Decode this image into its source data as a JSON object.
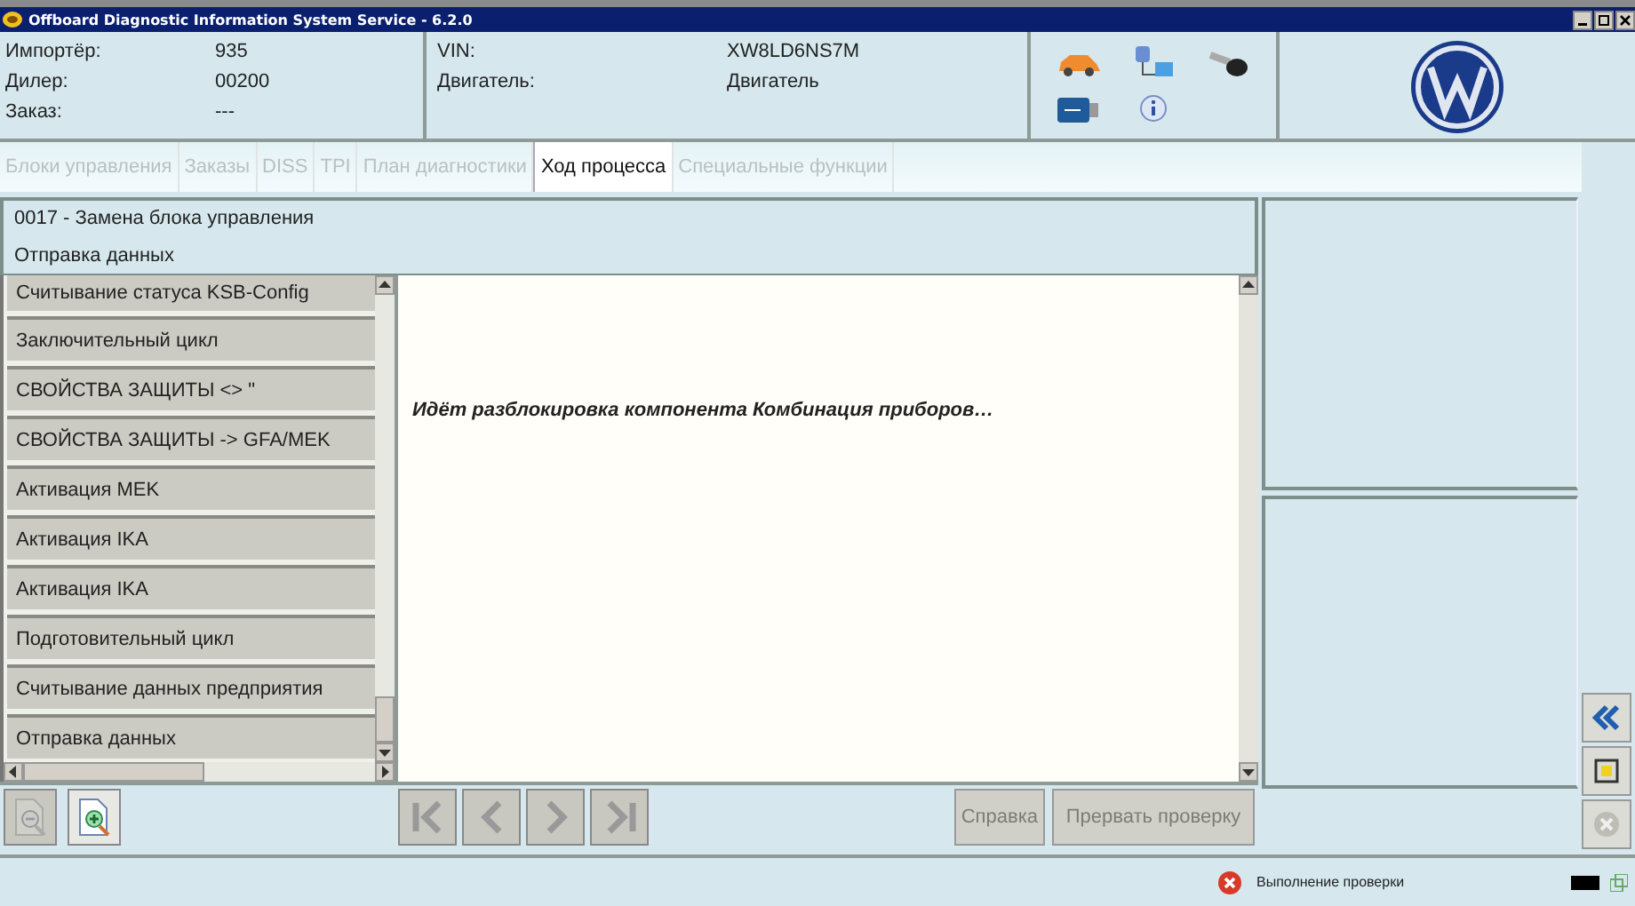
{
  "window": {
    "title": "Offboard Diagnostic Information System Service - 6.2.0"
  },
  "info": [
    {
      "label": "Импортёр:",
      "value": "935"
    },
    {
      "label": "Дилер:",
      "value": "00200"
    },
    {
      "label": "Заказ:",
      "value": "---"
    }
  ],
  "vehicle": [
    {
      "label": "VIN:",
      "value": "XW8LD6NS7M"
    },
    {
      "label": "Двигатель:",
      "value": "Двигатель"
    }
  ],
  "tabs": [
    {
      "label": "Блоки управления",
      "selected": false,
      "disabled": true
    },
    {
      "label": "Заказы",
      "selected": false,
      "disabled": true
    },
    {
      "label": "DISS",
      "selected": false,
      "disabled": true
    },
    {
      "label": "TPI",
      "selected": false,
      "disabled": true
    },
    {
      "label": "План диагностики",
      "selected": false,
      "disabled": true
    },
    {
      "label": "Ход процесса",
      "selected": true,
      "disabled": false
    },
    {
      "label": "Специальные функции",
      "selected": false,
      "disabled": true
    }
  ],
  "procedure": {
    "title": "0017 - Замена блока управления",
    "step": "Отправка данных"
  },
  "steps": [
    {
      "label": "Считывание статуса KSB-Config"
    },
    {
      "label": "Заключительный цикл"
    },
    {
      "label": "СВОЙСТВА ЗАЩИТЫ <> \""
    },
    {
      "label": "СВОЙСТВА ЗАЩИТЫ -> GFA/MEK"
    },
    {
      "label": "Активация MEK"
    },
    {
      "label": "Активация IKA"
    },
    {
      "label": "Активация IKA"
    },
    {
      "label": "Подготовительный цикл"
    },
    {
      "label": "Считывание данных предприятия"
    },
    {
      "label": "Отправка данных"
    }
  ],
  "message": "Идёт разблокировка компонента Комбинация приборов…",
  "zoom_buttons": [
    {
      "disabled": true
    },
    {
      "disabled": false
    }
  ],
  "nav_buttons": [
    {
      "disabled": true
    },
    {
      "disabled": true
    },
    {
      "disabled": true
    },
    {
      "disabled": true
    }
  ],
  "buttons": [
    {
      "label": "Справка",
      "disabled": true
    },
    {
      "label": "Прервать проверку",
      "disabled": true
    }
  ],
  "side_buttons": [
    {
      "disabled": false
    },
    {
      "disabled": false
    },
    {
      "disabled": true
    }
  ],
  "status": {
    "text": "Выполнение проверки"
  }
}
